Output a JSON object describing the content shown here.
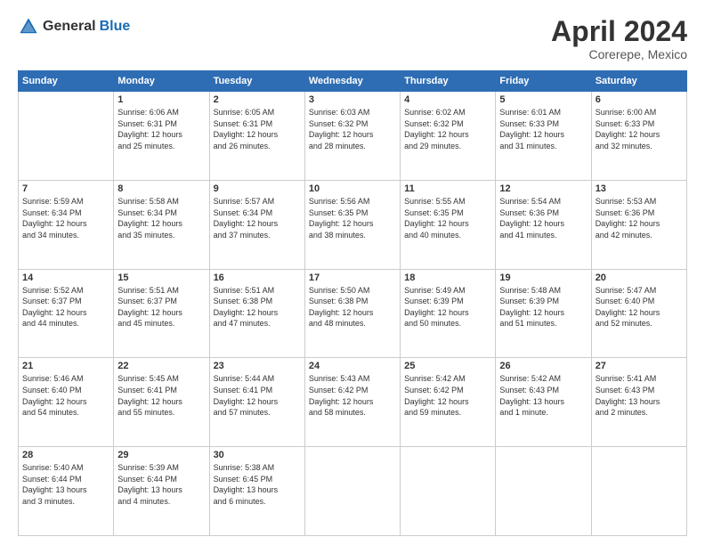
{
  "header": {
    "logo_general": "General",
    "logo_blue": "Blue",
    "title": "April 2024",
    "location": "Corerepe, Mexico"
  },
  "days_of_week": [
    "Sunday",
    "Monday",
    "Tuesday",
    "Wednesday",
    "Thursday",
    "Friday",
    "Saturday"
  ],
  "weeks": [
    [
      {
        "day": "",
        "info": ""
      },
      {
        "day": "1",
        "info": "Sunrise: 6:06 AM\nSunset: 6:31 PM\nDaylight: 12 hours\nand 25 minutes."
      },
      {
        "day": "2",
        "info": "Sunrise: 6:05 AM\nSunset: 6:31 PM\nDaylight: 12 hours\nand 26 minutes."
      },
      {
        "day": "3",
        "info": "Sunrise: 6:03 AM\nSunset: 6:32 PM\nDaylight: 12 hours\nand 28 minutes."
      },
      {
        "day": "4",
        "info": "Sunrise: 6:02 AM\nSunset: 6:32 PM\nDaylight: 12 hours\nand 29 minutes."
      },
      {
        "day": "5",
        "info": "Sunrise: 6:01 AM\nSunset: 6:33 PM\nDaylight: 12 hours\nand 31 minutes."
      },
      {
        "day": "6",
        "info": "Sunrise: 6:00 AM\nSunset: 6:33 PM\nDaylight: 12 hours\nand 32 minutes."
      }
    ],
    [
      {
        "day": "7",
        "info": "Sunrise: 5:59 AM\nSunset: 6:34 PM\nDaylight: 12 hours\nand 34 minutes."
      },
      {
        "day": "8",
        "info": "Sunrise: 5:58 AM\nSunset: 6:34 PM\nDaylight: 12 hours\nand 35 minutes."
      },
      {
        "day": "9",
        "info": "Sunrise: 5:57 AM\nSunset: 6:34 PM\nDaylight: 12 hours\nand 37 minutes."
      },
      {
        "day": "10",
        "info": "Sunrise: 5:56 AM\nSunset: 6:35 PM\nDaylight: 12 hours\nand 38 minutes."
      },
      {
        "day": "11",
        "info": "Sunrise: 5:55 AM\nSunset: 6:35 PM\nDaylight: 12 hours\nand 40 minutes."
      },
      {
        "day": "12",
        "info": "Sunrise: 5:54 AM\nSunset: 6:36 PM\nDaylight: 12 hours\nand 41 minutes."
      },
      {
        "day": "13",
        "info": "Sunrise: 5:53 AM\nSunset: 6:36 PM\nDaylight: 12 hours\nand 42 minutes."
      }
    ],
    [
      {
        "day": "14",
        "info": "Sunrise: 5:52 AM\nSunset: 6:37 PM\nDaylight: 12 hours\nand 44 minutes."
      },
      {
        "day": "15",
        "info": "Sunrise: 5:51 AM\nSunset: 6:37 PM\nDaylight: 12 hours\nand 45 minutes."
      },
      {
        "day": "16",
        "info": "Sunrise: 5:51 AM\nSunset: 6:38 PM\nDaylight: 12 hours\nand 47 minutes."
      },
      {
        "day": "17",
        "info": "Sunrise: 5:50 AM\nSunset: 6:38 PM\nDaylight: 12 hours\nand 48 minutes."
      },
      {
        "day": "18",
        "info": "Sunrise: 5:49 AM\nSunset: 6:39 PM\nDaylight: 12 hours\nand 50 minutes."
      },
      {
        "day": "19",
        "info": "Sunrise: 5:48 AM\nSunset: 6:39 PM\nDaylight: 12 hours\nand 51 minutes."
      },
      {
        "day": "20",
        "info": "Sunrise: 5:47 AM\nSunset: 6:40 PM\nDaylight: 12 hours\nand 52 minutes."
      }
    ],
    [
      {
        "day": "21",
        "info": "Sunrise: 5:46 AM\nSunset: 6:40 PM\nDaylight: 12 hours\nand 54 minutes."
      },
      {
        "day": "22",
        "info": "Sunrise: 5:45 AM\nSunset: 6:41 PM\nDaylight: 12 hours\nand 55 minutes."
      },
      {
        "day": "23",
        "info": "Sunrise: 5:44 AM\nSunset: 6:41 PM\nDaylight: 12 hours\nand 57 minutes."
      },
      {
        "day": "24",
        "info": "Sunrise: 5:43 AM\nSunset: 6:42 PM\nDaylight: 12 hours\nand 58 minutes."
      },
      {
        "day": "25",
        "info": "Sunrise: 5:42 AM\nSunset: 6:42 PM\nDaylight: 12 hours\nand 59 minutes."
      },
      {
        "day": "26",
        "info": "Sunrise: 5:42 AM\nSunset: 6:43 PM\nDaylight: 13 hours\nand 1 minute."
      },
      {
        "day": "27",
        "info": "Sunrise: 5:41 AM\nSunset: 6:43 PM\nDaylight: 13 hours\nand 2 minutes."
      }
    ],
    [
      {
        "day": "28",
        "info": "Sunrise: 5:40 AM\nSunset: 6:44 PM\nDaylight: 13 hours\nand 3 minutes."
      },
      {
        "day": "29",
        "info": "Sunrise: 5:39 AM\nSunset: 6:44 PM\nDaylight: 13 hours\nand 4 minutes."
      },
      {
        "day": "30",
        "info": "Sunrise: 5:38 AM\nSunset: 6:45 PM\nDaylight: 13 hours\nand 6 minutes."
      },
      {
        "day": "",
        "info": ""
      },
      {
        "day": "",
        "info": ""
      },
      {
        "day": "",
        "info": ""
      },
      {
        "day": "",
        "info": ""
      }
    ]
  ]
}
